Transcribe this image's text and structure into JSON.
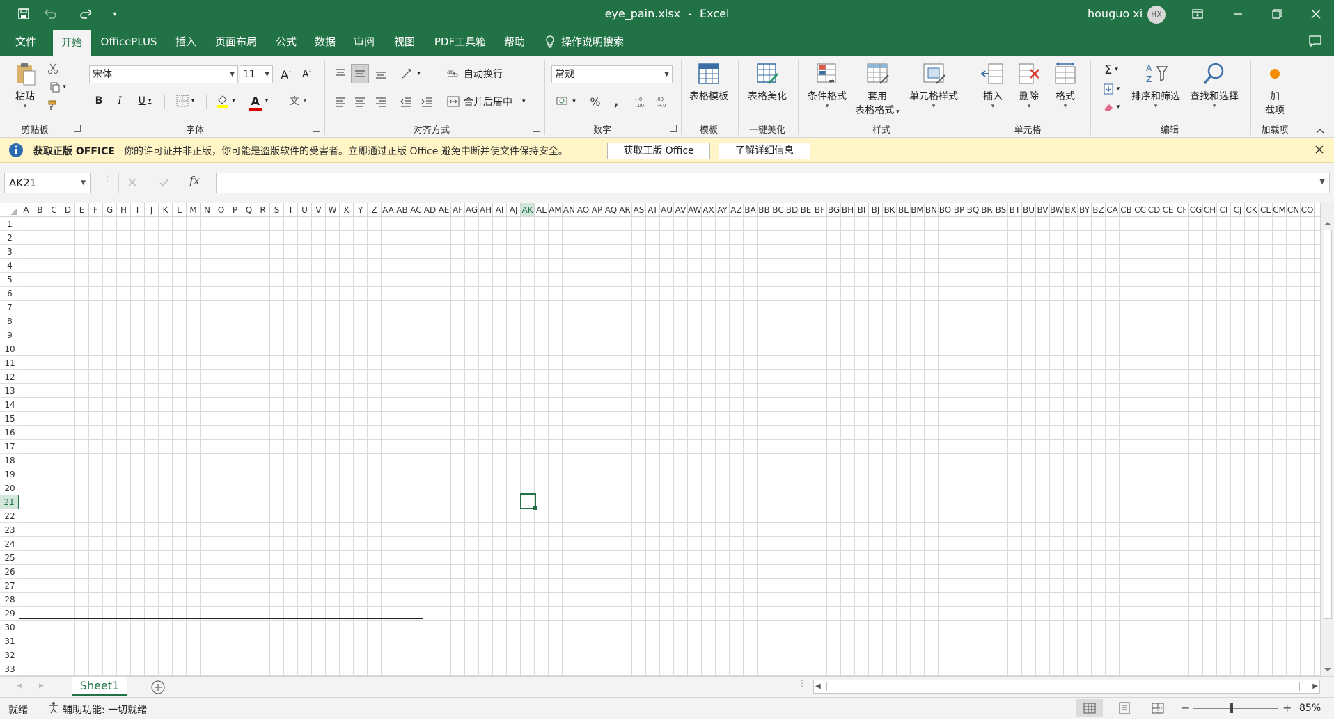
{
  "title_bar": {
    "file_name": "eye_pain.xlsx",
    "separator": "-",
    "app_name": "Excel",
    "user_name": "houguo xi",
    "avatar_initials": "HX"
  },
  "tabs": [
    {
      "label": "文件"
    },
    {
      "label": "开始"
    },
    {
      "label": "OfficePLUS"
    },
    {
      "label": "插入"
    },
    {
      "label": "页面布局"
    },
    {
      "label": "公式"
    },
    {
      "label": "数据"
    },
    {
      "label": "审阅"
    },
    {
      "label": "视图"
    },
    {
      "label": "PDF工具箱"
    },
    {
      "label": "帮助"
    },
    {
      "label": "操作说明搜索"
    }
  ],
  "ribbon": {
    "clipboard": {
      "paste": "粘贴",
      "group": "剪贴板"
    },
    "font": {
      "name": "宋体",
      "size": "11",
      "bold": "B",
      "italic": "I",
      "underline": "U",
      "grow": "A",
      "shrink": "A",
      "font_color": "A",
      "phonetic": "文",
      "group": "字体"
    },
    "alignment": {
      "wrap": "自动换行",
      "merge": "合并后居中",
      "group": "对齐方式"
    },
    "number": {
      "format": "常规",
      "percent": "%",
      "comma": ",",
      "group": "数字"
    },
    "template": {
      "label": "表格模板",
      "group": "模板"
    },
    "beautify": {
      "label": "表格美化",
      "group": "一键美化"
    },
    "styles": {
      "conditional": "条件格式",
      "table_line1": "套用",
      "table_line2": "表格格式",
      "cell_styles": "单元格样式",
      "group": "样式"
    },
    "cells": {
      "insert": "插入",
      "delete": "删除",
      "format": "格式",
      "group": "单元格"
    },
    "editing": {
      "sum": "Σ",
      "sort": "排序和筛选",
      "find": "查找和选择",
      "group": "编辑"
    },
    "addins": {
      "line1": "加",
      "line2": "载项",
      "group": "加载项"
    }
  },
  "message_bar": {
    "title": "获取正版 OFFICE",
    "text": "你的许可证并非正版，你可能是盗版软件的受害者。立即通过正版 Office 避免中断并使文件保持安全。",
    "button1": "获取正版 Office",
    "button2": "了解详细信息"
  },
  "formula_bar": {
    "name_box": "AK21",
    "fx": "fx",
    "value": ""
  },
  "columns": [
    "A",
    "B",
    "C",
    "D",
    "E",
    "F",
    "G",
    "H",
    "I",
    "J",
    "K",
    "L",
    "M",
    "N",
    "O",
    "P",
    "Q",
    "R",
    "S",
    "T",
    "U",
    "V",
    "W",
    "X",
    "Y",
    "Z",
    "AA",
    "AB",
    "AC",
    "AD",
    "AE",
    "AF",
    "AG",
    "AH",
    "AI",
    "AJ",
    "AK",
    "AL",
    "AM",
    "AN",
    "AO",
    "AP",
    "AQ",
    "AR",
    "AS",
    "AT",
    "AU",
    "AV",
    "AW",
    "AX",
    "AY",
    "AZ",
    "BA",
    "BB",
    "BC",
    "BD",
    "BE",
    "BF",
    "BG",
    "BH",
    "BI",
    "BJ",
    "BK",
    "BL",
    "BM",
    "BN",
    "BO",
    "BP",
    "BQ",
    "BR",
    "BS",
    "BT",
    "BU",
    "BV",
    "BW",
    "BX",
    "BY",
    "BZ",
    "CA",
    "CB",
    "CC",
    "CD",
    "CE",
    "CF",
    "CG",
    "CH",
    "CI",
    "CJ",
    "CK",
    "CL",
    "CM",
    "CN",
    "CO"
  ],
  "selected_column": "AK",
  "selected_row": "21",
  "rows": [
    "1",
    "2",
    "3",
    "4",
    "5",
    "6",
    "7",
    "8",
    "9",
    "10",
    "11",
    "12",
    "13",
    "14",
    "15",
    "16",
    "17",
    "18",
    "19",
    "20",
    "21",
    "22",
    "23",
    "24",
    "25",
    "26",
    "27",
    "28",
    "29",
    "30",
    "31",
    "32",
    "33"
  ],
  "sheets": [
    {
      "name": "Sheet1"
    }
  ],
  "status_bar": {
    "ready": "就绪",
    "accessibility": "辅助功能: 一切就绪",
    "zoom": "85%",
    "zoom_minus": "−",
    "zoom_plus": "+"
  },
  "colors": {
    "accent": "#217346",
    "message_bar": "#fff5c6",
    "info_icon": "#2b6cb0"
  }
}
